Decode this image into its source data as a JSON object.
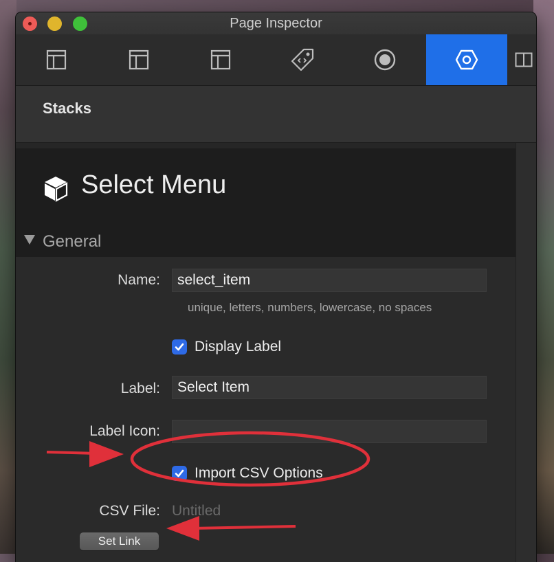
{
  "window": {
    "title": "Page Inspector"
  },
  "toolbar": {
    "tabs": [
      {
        "icon": "layout-icon"
      },
      {
        "icon": "layout-icon"
      },
      {
        "icon": "layout-icon"
      },
      {
        "icon": "tag-icon"
      },
      {
        "icon": "circle-icon"
      },
      {
        "icon": "hexagon-gear-icon",
        "active": true
      }
    ],
    "side_icon": "split-panel-icon"
  },
  "stacks_bar": {
    "title": "Stacks"
  },
  "stack": {
    "title": "Select Menu",
    "icon": "cube-icon"
  },
  "section": {
    "title": "General",
    "expanded": true
  },
  "fields": {
    "name": {
      "label": "Name:",
      "value": "select_item",
      "hint": "unique, letters, numbers, lowercase, no spaces"
    },
    "display_label": {
      "label": "Display Label",
      "checked": true
    },
    "label": {
      "label": "Label:",
      "value": "Select Item"
    },
    "label_icon": {
      "label": "Label Icon:",
      "value": ""
    },
    "import_csv": {
      "label": "Import CSV Options",
      "checked": true
    },
    "csv_file": {
      "label": "CSV File:",
      "value": "Untitled"
    },
    "set_link": {
      "label": "Set Link"
    }
  },
  "colors": {
    "accent": "#1f6fe8",
    "annotation": "#e0303a"
  }
}
